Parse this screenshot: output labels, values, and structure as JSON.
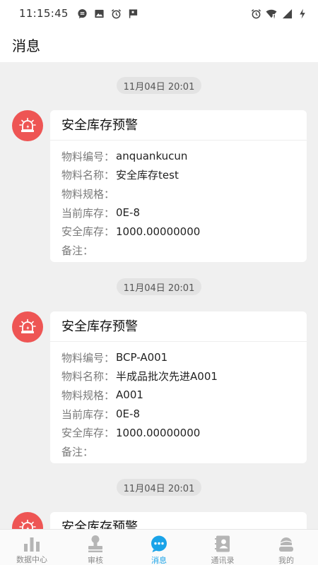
{
  "status_bar": {
    "time": "11:15:45"
  },
  "header": {
    "title": "消息"
  },
  "messages": [
    {
      "timestamp": "11月04日  20:01",
      "title": "安全库存预警",
      "fields": [
        {
          "label": "物料编号：",
          "value": "anquankucun"
        },
        {
          "label": "物料名称：",
          "value": "安全库存test"
        },
        {
          "label": "物料规格：",
          "value": ""
        },
        {
          "label": "当前库存：",
          "value": "0E-8"
        },
        {
          "label": "安全库存：",
          "value": "1000.00000000"
        },
        {
          "label": "备注：",
          "value": ""
        }
      ]
    },
    {
      "timestamp": "11月04日  20:01",
      "title": "安全库存预警",
      "fields": [
        {
          "label": "物料编号：",
          "value": "BCP-A001"
        },
        {
          "label": "物料名称：",
          "value": "半成品批次先进A001"
        },
        {
          "label": "物料规格：",
          "value": "A001"
        },
        {
          "label": "当前库存：",
          "value": "0E-8"
        },
        {
          "label": "安全库存：",
          "value": "1000.00000000"
        },
        {
          "label": "备注：",
          "value": ""
        }
      ]
    },
    {
      "timestamp": "11月04日  20:01",
      "title": "安全库存预警",
      "fields": []
    }
  ],
  "tab_bar": {
    "items": [
      {
        "label": "数据中心",
        "icon": "bar-chart-icon",
        "active": false
      },
      {
        "label": "审核",
        "icon": "stamp-icon",
        "active": false
      },
      {
        "label": "消息",
        "icon": "chat-bubble-icon",
        "active": true
      },
      {
        "label": "通讯录",
        "icon": "contacts-book-icon",
        "active": false
      },
      {
        "label": "我的",
        "icon": "user-profile-icon",
        "active": false
      }
    ]
  },
  "colors": {
    "accent": "#1aa3e8",
    "alert_avatar": "#ee5554",
    "background": "#f0f0f0",
    "tab_inactive": "#b5b5b5"
  }
}
